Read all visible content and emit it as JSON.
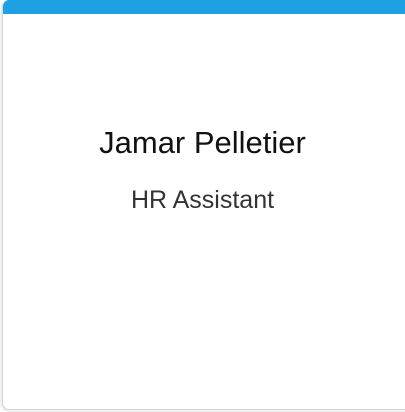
{
  "card": {
    "name": "Jamar Pelletier",
    "title": "HR Assistant",
    "accent_color": "#1ea0e4"
  }
}
